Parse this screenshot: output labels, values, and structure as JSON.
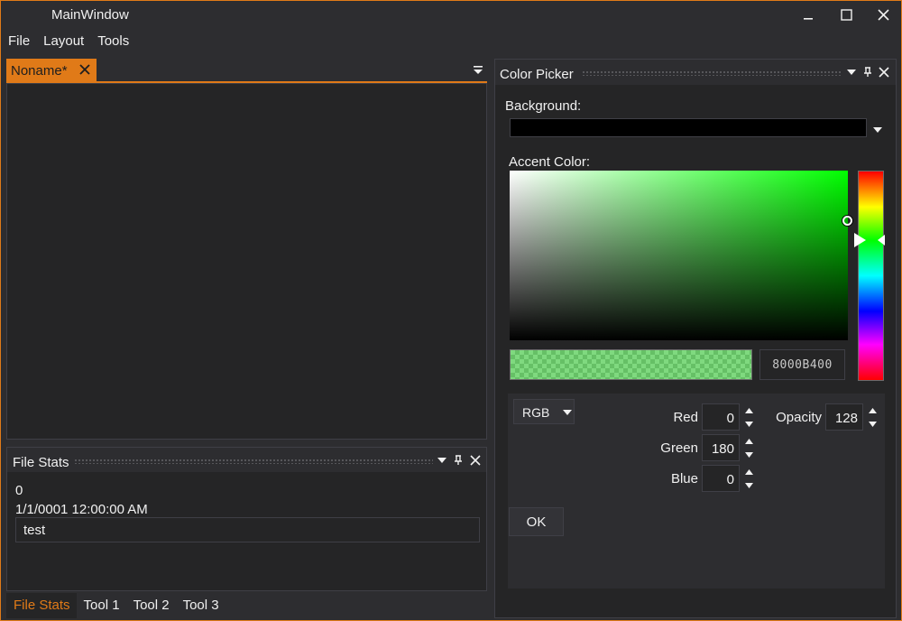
{
  "window": {
    "title": "MainWindow",
    "controls": {
      "minimize": "minimize-icon",
      "maximize": "maximize-icon",
      "close": "close-icon"
    }
  },
  "menu": [
    "File",
    "Layout",
    "Tools"
  ],
  "document": {
    "tab_label": "Noname*",
    "tab_close_icon": "close-icon",
    "tab_menu_icon": "chevron-down-icon",
    "accent": "#e07a18"
  },
  "file_stats": {
    "title": "File Stats",
    "size_value": "0",
    "date_value": "1/1/0001 12:00:00 AM",
    "text_value": "test"
  },
  "bottom_tabs": [
    {
      "label": "File Stats",
      "active": true
    },
    {
      "label": "Tool 1",
      "active": false
    },
    {
      "label": "Tool 2",
      "active": false
    },
    {
      "label": "Tool 3",
      "active": false
    }
  ],
  "color_picker": {
    "title": "Color Picker",
    "background_label": "Background:",
    "background_value": "#000000",
    "accent_label": "Accent Color:",
    "hue_color": "#00ff00",
    "hex_value": "8000B400",
    "preview_color": "#00b400",
    "preview_opacity": 0.5,
    "mode": "RGB",
    "red_label": "Red",
    "red": "0",
    "green_label": "Green",
    "green": "180",
    "blue_label": "Blue",
    "blue": "0",
    "opacity_label": "Opacity",
    "opacity": "128",
    "ok_label": "OK"
  }
}
